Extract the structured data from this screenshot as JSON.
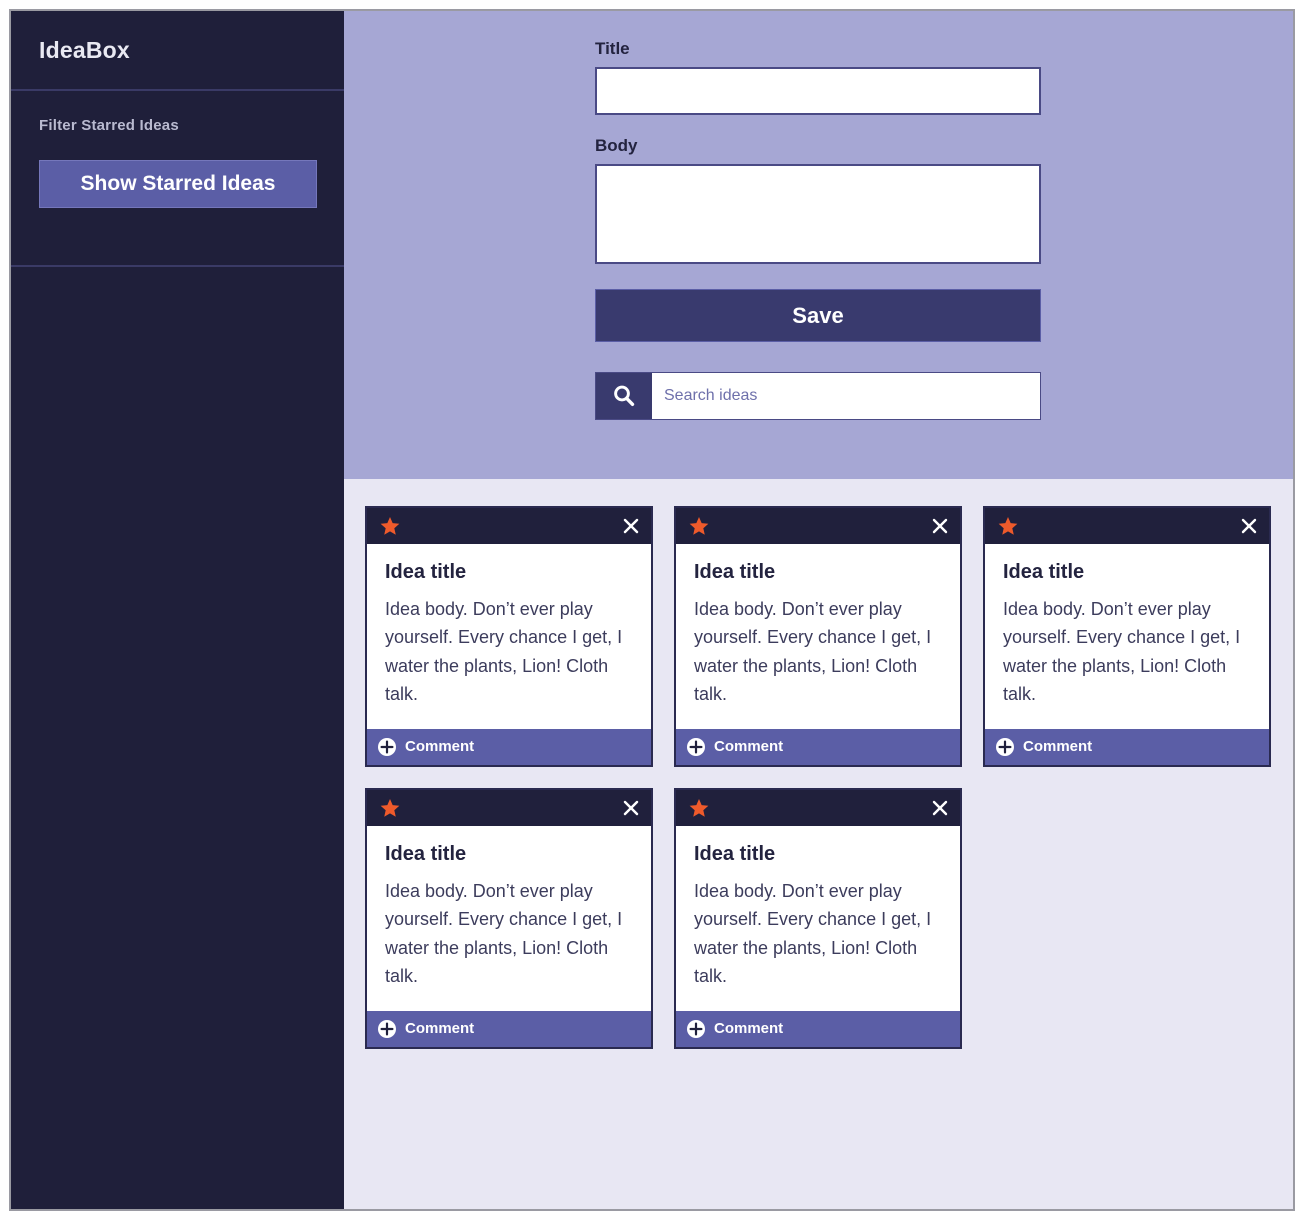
{
  "app": {
    "brand": "IdeaBox"
  },
  "sidebar": {
    "filter_label": "Filter Starred Ideas",
    "starred_button_label": "Show Starred Ideas"
  },
  "form": {
    "title_label": "Title",
    "title_value": "",
    "title_placeholder": "",
    "body_label": "Body",
    "body_value": "",
    "body_placeholder": "",
    "save_label": "Save",
    "search_value": "",
    "search_placeholder": "Search ideas",
    "search_icon": "search-icon"
  },
  "card_labels": {
    "comment": "Comment",
    "star_icon": "star-icon",
    "close_icon": "close-icon",
    "plus_icon": "plus-circle-icon"
  },
  "ideas": [
    {
      "title": "Idea title",
      "body": "Idea body. Don’t ever play yourself. Every chance I get, I water the plants, Lion! Cloth talk.",
      "comment": "Comment",
      "starred": true
    },
    {
      "title": "Idea title",
      "body": "Idea body. Don’t ever play yourself. Every chance I get, I water the plants, Lion! Cloth talk.",
      "comment": "Comment",
      "starred": true
    },
    {
      "title": "Idea title",
      "body": "Idea body. Don’t ever play yourself. Every chance I get, I water the plants, Lion! Cloth talk.",
      "comment": "Comment",
      "starred": true
    },
    {
      "title": "Idea title",
      "body": "Idea body. Don’t ever play yourself. Every chance I get, I water the plants, Lion! Cloth talk.",
      "comment": "Comment",
      "starred": true
    },
    {
      "title": "Idea title",
      "body": "Idea body. Don’t ever play yourself. Every chance I get, I water the plants, Lion! Cloth talk.",
      "comment": "Comment",
      "starred": true
    }
  ],
  "colors": {
    "sidebar_bg": "#1f1f3a",
    "form_bg": "#a6a7d4",
    "content_bg": "#e8e7f3",
    "accent_purple": "#5b5ea6",
    "dark_navy": "#20203c",
    "star_orange": "#ee5a2b",
    "save_navy": "#393a6e"
  }
}
